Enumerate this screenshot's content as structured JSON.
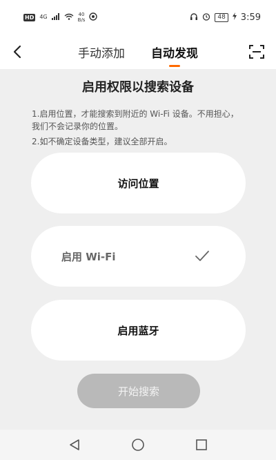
{
  "status_bar": {
    "hd_label": "HD",
    "network_label": "4G",
    "speed_value": "40",
    "speed_unit": "B/s",
    "battery": "48",
    "time": "3:59"
  },
  "nav": {
    "tabs": [
      {
        "label": "手动添加",
        "active": false
      },
      {
        "label": "自动发现",
        "active": true
      }
    ]
  },
  "main": {
    "title": "启用权限以搜索设备",
    "instructions": [
      "1.启用位置，才能搜索到附近的 Wi-Fi 设备。不用担心，我们不会记录你的位置。",
      "2.如不确定设备类型，建议全部开启。"
    ],
    "permissions": [
      {
        "label": "访问位置",
        "enabled": false
      },
      {
        "label": "启用 Wi-Fi",
        "enabled": true
      },
      {
        "label": "启用蓝牙",
        "enabled": false
      }
    ],
    "start_button": "开始搜索"
  },
  "colors": {
    "accent": "#ff6a00",
    "background": "#efefef",
    "card": "#ffffff",
    "disabled_button": "#b9b9b9"
  }
}
